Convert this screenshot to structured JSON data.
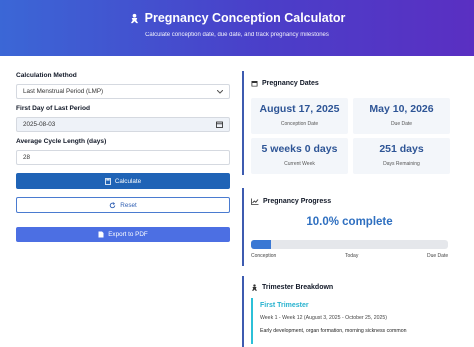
{
  "header": {
    "title": "Pregnancy Conception Calculator",
    "subtitle": "Calculate conception date, due date, and track pregnancy milestones"
  },
  "form": {
    "method_label": "Calculation Method",
    "method_value": "Last Menstrual Period (LMP)",
    "lmp_label": "First Day of Last Period",
    "lmp_value": "2025-08-03",
    "cycle_label": "Average Cycle Length (days)",
    "cycle_value": "28",
    "calculate_label": "Calculate",
    "reset_label": "Reset",
    "export_label": "Export to PDF"
  },
  "dates": {
    "title": "Pregnancy Dates",
    "conception_value": "August 17, 2025",
    "conception_caption": "Conception Date",
    "due_value": "May 10, 2026",
    "due_caption": "Due Date",
    "week_value": "5 weeks 0 days",
    "week_caption": "Current Week",
    "remaining_value": "251 days",
    "remaining_caption": "Days Remaining"
  },
  "progress": {
    "title": "Pregnancy Progress",
    "text": "10.0% complete",
    "fraction": 0.1,
    "start_label": "Conception",
    "mid_label": "Today",
    "end_label": "Due Date"
  },
  "trimester": {
    "title": "Trimester Breakdown",
    "name": "First Trimester",
    "range": "Week 1 - Week 12 (August 3, 2025 - October 25, 2025)",
    "description": "Early development, organ formation, morning sickness common"
  },
  "colors": {
    "header_start": "#3b67d6",
    "header_end": "#5a2fc2",
    "accent": "#1f63b6",
    "trimester": "#26b2cf"
  }
}
